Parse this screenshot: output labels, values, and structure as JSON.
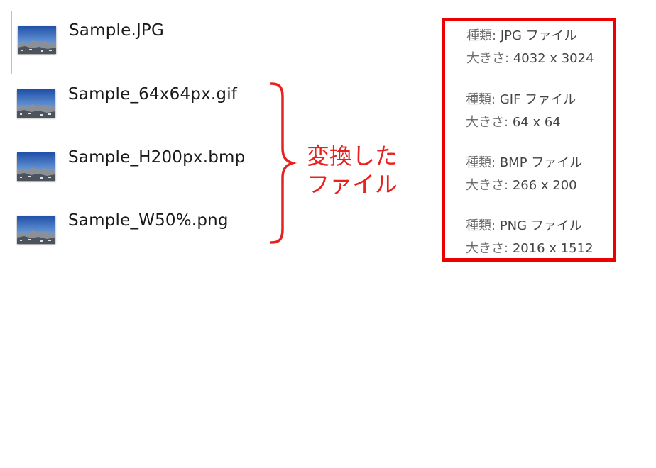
{
  "files": [
    {
      "name": "Sample.JPG",
      "type_label": "種類:",
      "type_value": "JPG ファイル",
      "size_label": "大きさ:",
      "size_value": "4032 x 3024",
      "selected": true
    },
    {
      "name": "Sample_64x64px.gif",
      "type_label": "種類:",
      "type_value": "GIF ファイル",
      "size_label": "大きさ:",
      "size_value": "64 x 64",
      "selected": false
    },
    {
      "name": "Sample_H200px.bmp",
      "type_label": "種類:",
      "type_value": "BMP ファイル",
      "size_label": "大きさ:",
      "size_value": "266 x 200",
      "selected": false
    },
    {
      "name": "Sample_W50%.png",
      "type_label": "種類:",
      "type_value": "PNG ファイル",
      "size_label": "大きさ:",
      "size_value": "2016 x 1512",
      "selected": false
    }
  ],
  "annotation": {
    "line1": "変換した",
    "line2": "ファイル",
    "color": "#e82020"
  },
  "highlight_color": "#ee0000",
  "selection_border_color": "#9cc7ef",
  "thumbnail_icon": "image-file-icon"
}
